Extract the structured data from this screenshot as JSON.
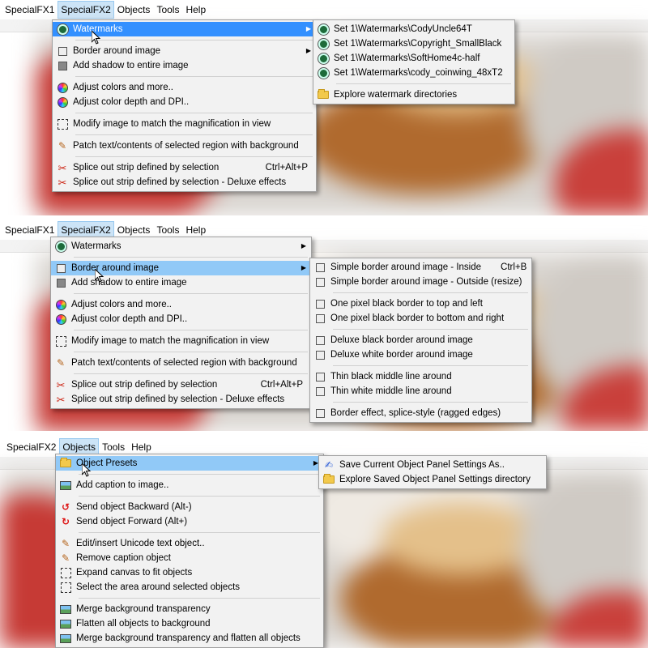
{
  "panel1": {
    "menubar": [
      "SpecialFX1",
      "SpecialFX2",
      "Objects",
      "Tools",
      "Help"
    ],
    "active_menu": "SpecialFX2",
    "menu": [
      {
        "label": "Watermarks",
        "icon": "watermark-icon",
        "submenu": true,
        "highlighted": true
      },
      {
        "sep": true
      },
      {
        "label": "Border around image",
        "icon": "border-icon",
        "submenu": true
      },
      {
        "label": "Add shadow to entire image",
        "icon": "shadow-icon"
      },
      {
        "sep": true
      },
      {
        "label": "Adjust colors and more..",
        "icon": "color-wheel-icon"
      },
      {
        "label": "Adjust color depth and DPI..",
        "icon": "color-wheel-icon"
      },
      {
        "sep": true
      },
      {
        "label": "Modify image to match the magnification in view",
        "icon": "magnify-icon"
      },
      {
        "sep": true
      },
      {
        "label": "Patch text/contents of selected region with background",
        "icon": "patch-icon"
      },
      {
        "sep": true
      },
      {
        "label": "Splice out strip defined by selection",
        "icon": "scissors-icon",
        "shortcut": "Ctrl+Alt+P"
      },
      {
        "label": "Splice out strip defined by selection - Deluxe effects",
        "icon": "scissors-icon"
      }
    ],
    "submenu": [
      {
        "label": "Set 1\\Watermarks\\CodyUncle64T",
        "icon": "watermark-icon"
      },
      {
        "label": "Set 1\\Watermarks\\Copyright_SmallBlack",
        "icon": "watermark-icon"
      },
      {
        "label": "Set 1\\Watermarks\\SoftHome4c-half",
        "icon": "watermark-icon"
      },
      {
        "label": "Set 1\\Watermarks\\cody_coinwing_48xT2",
        "icon": "watermark-icon"
      },
      {
        "sep": true
      },
      {
        "label": "Explore watermark directories",
        "icon": "folder-icon"
      }
    ]
  },
  "panel2": {
    "menubar": [
      "SpecialFX1",
      "SpecialFX2",
      "Objects",
      "Tools",
      "Help"
    ],
    "active_menu": "SpecialFX2",
    "menu": [
      {
        "label": "Watermarks",
        "icon": "watermark-icon",
        "submenu": true
      },
      {
        "sep": true
      },
      {
        "label": "Border around image",
        "icon": "border-icon",
        "submenu": true,
        "highlighted": true
      },
      {
        "label": "Add shadow to entire image",
        "icon": "shadow-icon"
      },
      {
        "sep": true
      },
      {
        "label": "Adjust colors and more..",
        "icon": "color-wheel-icon"
      },
      {
        "label": "Adjust color depth and DPI..",
        "icon": "color-wheel-icon"
      },
      {
        "sep": true
      },
      {
        "label": "Modify image to match the magnification in view",
        "icon": "magnify-icon"
      },
      {
        "sep": true
      },
      {
        "label": "Patch text/contents of selected region with background",
        "icon": "patch-icon"
      },
      {
        "sep": true
      },
      {
        "label": "Splice out strip defined by selection",
        "icon": "scissors-icon",
        "shortcut": "Ctrl+Alt+P"
      },
      {
        "label": "Splice out strip defined by selection - Deluxe effects",
        "icon": "scissors-icon"
      }
    ],
    "submenu": [
      {
        "label": "Simple border around image - Inside",
        "icon": "border-icon",
        "shortcut": "Ctrl+B"
      },
      {
        "label": "Simple border around image - Outside (resize)",
        "icon": "border-icon"
      },
      {
        "sep": true
      },
      {
        "label": "One pixel black border to top and left",
        "icon": "border-icon"
      },
      {
        "label": "One pixel black border to bottom and right",
        "icon": "border-icon"
      },
      {
        "sep": true
      },
      {
        "label": "Deluxe black border around image",
        "icon": "border-icon"
      },
      {
        "label": "Deluxe white border around image",
        "icon": "border-icon"
      },
      {
        "sep": true
      },
      {
        "label": "Thin black middle line around",
        "icon": "border-icon"
      },
      {
        "label": "Thin white middle line around",
        "icon": "border-icon"
      },
      {
        "sep": true
      },
      {
        "label": "Border effect, splice-style (ragged edges)",
        "icon": "border-icon"
      }
    ]
  },
  "panel3": {
    "menubar": [
      "SpecialFX2",
      "Objects",
      "Tools",
      "Help"
    ],
    "active_menu": "Objects",
    "menu": [
      {
        "label": "Object Presets",
        "icon": "folder-icon",
        "submenu": true,
        "highlighted": true
      },
      {
        "sep": true
      },
      {
        "label": "Add caption to image..",
        "icon": "picture-icon"
      },
      {
        "sep": true
      },
      {
        "label": "Send object Backward  (Alt-)",
        "icon": "send-backward-icon"
      },
      {
        "label": "Send object Forward  (Alt+)",
        "icon": "send-forward-icon"
      },
      {
        "sep": true
      },
      {
        "label": "Edit/insert Unicode text object..",
        "icon": "pencil-icon"
      },
      {
        "label": "Remove caption object",
        "icon": "pencil-icon"
      },
      {
        "label": "Expand canvas to fit objects",
        "icon": "expand-icon"
      },
      {
        "label": "Select the area around selected objects",
        "icon": "select-icon"
      },
      {
        "sep": true
      },
      {
        "label": "Merge background transparency",
        "icon": "picture-icon"
      },
      {
        "label": "Flatten all objects to background",
        "icon": "picture-icon"
      },
      {
        "label": "Merge background transparency and flatten all objects",
        "icon": "picture-icon"
      }
    ],
    "submenu": [
      {
        "label": "Save Current Object Panel Settings As..",
        "icon": "save-settings-icon"
      },
      {
        "label": "Explore Saved Object Panel Settings directory",
        "icon": "folder-icon"
      }
    ]
  }
}
